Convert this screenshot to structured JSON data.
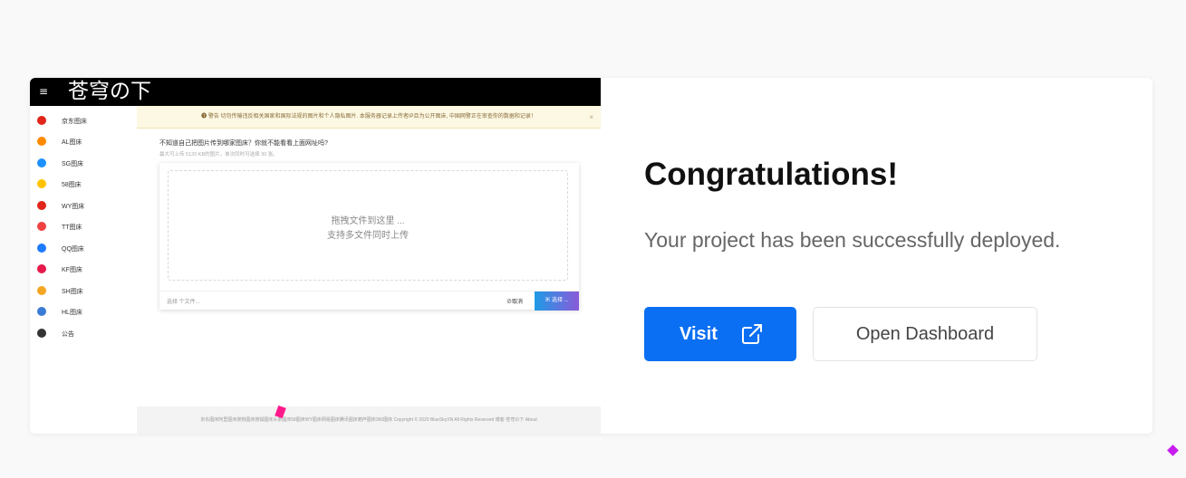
{
  "preview": {
    "menu_icon": "≡",
    "brand": "苍穹の下",
    "sidebar": [
      {
        "label": "京东图床",
        "color": "#e1251b"
      },
      {
        "label": "AL图床",
        "color": "#ff8a00"
      },
      {
        "label": "SG图床",
        "color": "#1e90ff"
      },
      {
        "label": "58图床",
        "color": "#ffc300"
      },
      {
        "label": "WY图床",
        "color": "#e1251b"
      },
      {
        "label": "TT图床",
        "color": "#f04142"
      },
      {
        "label": "QQ图床",
        "color": "#1e7bff"
      },
      {
        "label": "KF图床",
        "color": "#e6194a"
      },
      {
        "label": "SH图床",
        "color": "#f5a623"
      },
      {
        "label": "HL图床",
        "color": "#3a7bd5"
      },
      {
        "label": "公告",
        "color": "#333333"
      }
    ],
    "warning": "❶ 警告 切勿传输违反相关国家和国际法规的图片和个人隐私图片. 本服务器记录上传者IP且为公开图床, 中国网警正在审查你的数据和记录！",
    "warning_close": "×",
    "question": "不知道自己把图片传到哪家图床？你就不能看看上面网址吗?",
    "limit": "最大可上传 5120 KB的图片，单次同时可选择 30 张。",
    "drop_line1": "拖拽文件到这里 ...",
    "drop_line2": "支持多文件同时上传",
    "file_placeholder": "选择 个文件...",
    "cancel_label": "⊘取消",
    "choose_label": "▣ 选择 ...",
    "footer": "京东图床阿里图床搜狗图床搜狐图床头条图床58图床WY图床网易图床腾讯图床葫芦图床360图床 Copyright © 2020 BlueSkyXN All Rights Reserved 博客·苍穹の下 About"
  },
  "main": {
    "title": "Congratulations!",
    "message": "Your project has been successfully deployed.",
    "visit_label": "Visit",
    "dashboard_label": "Open Dashboard"
  },
  "colors": {
    "primary": "#0a6ff2",
    "background": "#f9f9f9"
  }
}
